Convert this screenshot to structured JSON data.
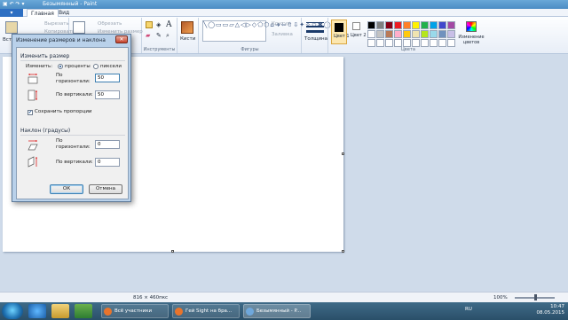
{
  "window": {
    "title": "Безымянный - Paint"
  },
  "tabs": {
    "file_label": "▾",
    "items": [
      "Главная",
      "Вид"
    ]
  },
  "ribbon": {
    "clipboard": {
      "paste_label": "Вставить",
      "cut_label": "Вырезать",
      "copy_label": "Копировать"
    },
    "image": {
      "crop_label": "Обрезать",
      "resize_label": "Изменить размер"
    },
    "tools_label": "Инструменты",
    "brushes_label": "Кисти",
    "shapes_label": "Фигуры",
    "outline_label": "Контур",
    "fill_label": "Заливка",
    "thickness_label": "Толщина",
    "color1_label": "Цвет 1",
    "color2_label": "Цвет 2",
    "colors_group_label": "Цвета",
    "edit_colors_label": "Изменение цветов",
    "palette_row1": [
      "#000000",
      "#7f7f7f",
      "#880015",
      "#ed1c24",
      "#ff7f27",
      "#fff200",
      "#22b14c",
      "#00a2e8",
      "#3f48cc",
      "#a349a4"
    ],
    "palette_row2": [
      "#ffffff",
      "#c3c3c3",
      "#b97a57",
      "#ffaec9",
      "#ffc90e",
      "#efe4b0",
      "#b5e61d",
      "#99d9ea",
      "#7092be",
      "#c8bfe7"
    ]
  },
  "dialog": {
    "title": "Изменение размеров и наклона",
    "close_label": "✕",
    "resize_section": "Изменить размер",
    "by_label": "Изменить:",
    "percent_label": "проценты",
    "pixels_label": "пиксели",
    "horizontal_label": "По горизонтали:",
    "vertical_label": "По вертикали:",
    "resize_h_value": "50",
    "resize_v_value": "50",
    "keep_ratio_label": "Сохранить пропорции",
    "skew_section": "Наклон (градусы)",
    "skew_h_label": "По горизонтали:",
    "skew_v_label": "По вертикали:",
    "skew_h_value": "0",
    "skew_v_value": "0",
    "ok_label": "ОК",
    "cancel_label": "Отмена"
  },
  "status": {
    "dimensions": "816 × 460пкс",
    "zoom": "100%"
  },
  "taskbar": {
    "tasks": [
      {
        "label": "Всё участники"
      },
      {
        "label": "Гей Sight на бра..."
      },
      {
        "label": "Безымянный - P..."
      }
    ],
    "language": "RU",
    "time": "10:47",
    "date": "08.05.2015"
  }
}
